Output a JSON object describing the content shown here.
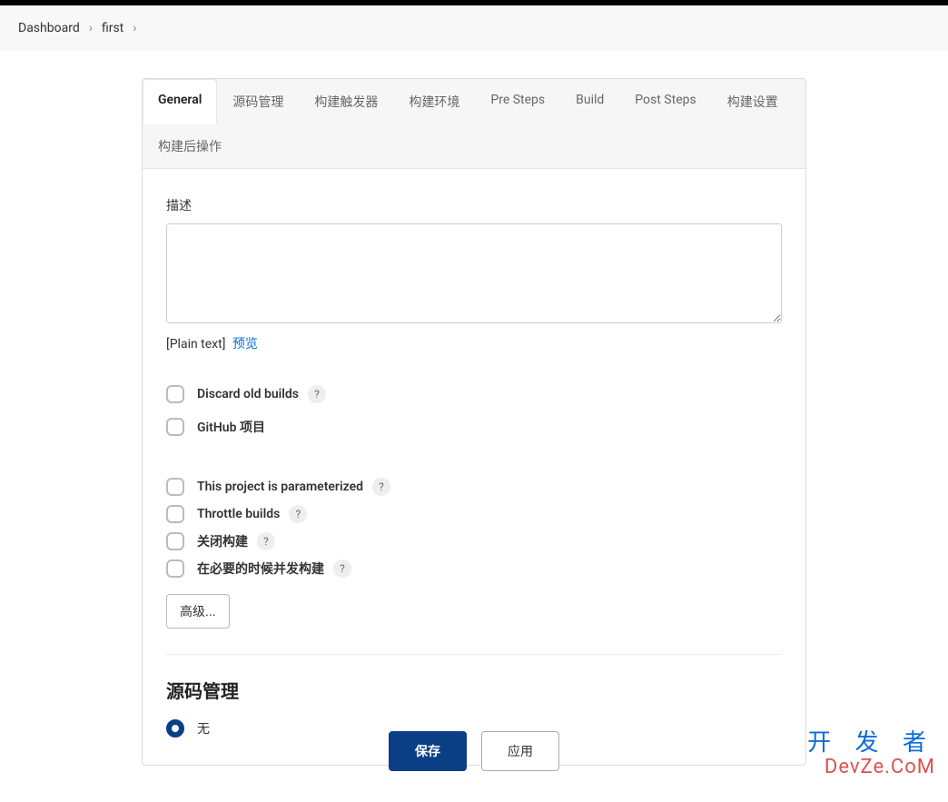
{
  "breadcrumb": {
    "items": [
      "Dashboard",
      "first"
    ]
  },
  "tabs": [
    {
      "label": "General",
      "active": true
    },
    {
      "label": "源码管理",
      "active": false
    },
    {
      "label": "构建触发器",
      "active": false
    },
    {
      "label": "构建环境",
      "active": false
    },
    {
      "label": "Pre Steps",
      "active": false
    },
    {
      "label": "Build",
      "active": false
    },
    {
      "label": "Post Steps",
      "active": false
    },
    {
      "label": "构建设置",
      "active": false
    },
    {
      "label": "构建后操作",
      "active": false
    }
  ],
  "description": {
    "label": "描述",
    "value": "",
    "format_label": "[Plain text]",
    "preview_label": "预览"
  },
  "general_options_group1": [
    {
      "label": "Discard old builds",
      "help": true
    },
    {
      "label": "GitHub 项目",
      "help": false
    }
  ],
  "general_options_group2": [
    {
      "label": "This project is parameterized",
      "help": true
    },
    {
      "label": "Throttle builds",
      "help": true
    },
    {
      "label": "关闭构建",
      "help": true
    },
    {
      "label": "在必要的时候并发构建",
      "help": true
    }
  ],
  "advanced_button": "高级...",
  "scm": {
    "title": "源码管理",
    "options": [
      {
        "label": "无",
        "selected": true
      }
    ]
  },
  "footer": {
    "save": "保存",
    "apply": "应用"
  },
  "watermark": {
    "line1": "开 发 者",
    "line2": "DevZe.CoM"
  }
}
